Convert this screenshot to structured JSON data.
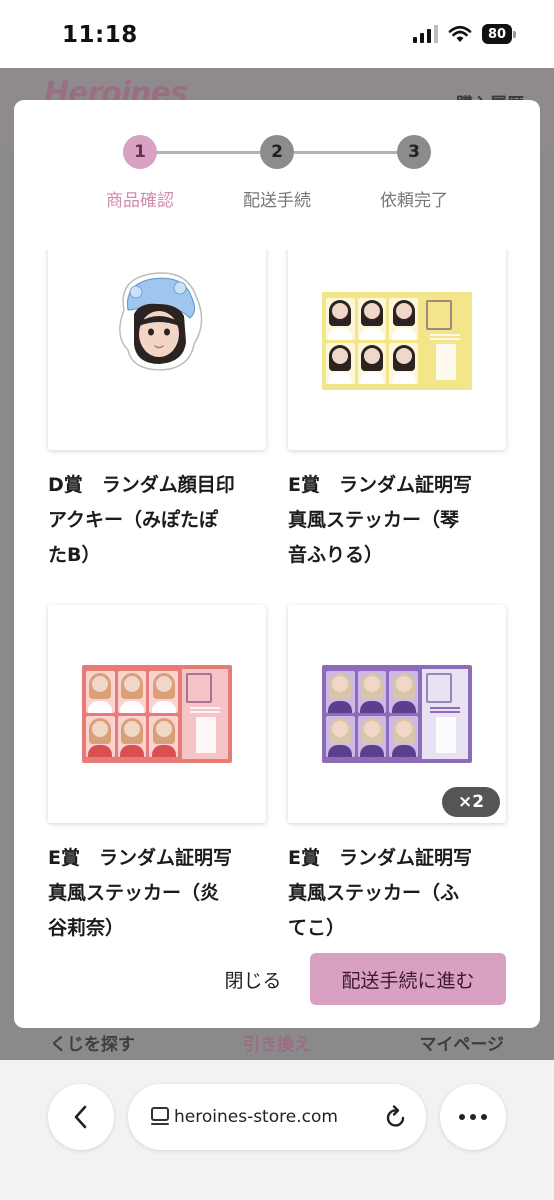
{
  "status_bar": {
    "time": "11:18",
    "battery": "80"
  },
  "background_page": {
    "logo": "Heroines",
    "header_right": "購入履歴",
    "nav": [
      "くじを探す",
      "引き換え",
      "マイページ"
    ]
  },
  "stepper": {
    "steps": [
      {
        "number": "1",
        "label": "商品確認",
        "active": true
      },
      {
        "number": "2",
        "label": "配送手続",
        "active": false
      },
      {
        "number": "3",
        "label": "依頼完了",
        "active": false
      }
    ]
  },
  "items": [
    {
      "title": "D賞　ランダム顔目印アクキー（みぽたぽB）",
      "lines": [
        "D賞　ランダム顔目印",
        "アクキー（みぽたぽ",
        "たB）"
      ],
      "image": "face-sticker",
      "quantity": ""
    },
    {
      "title": "E賞　ランダム証明写真風ステッカー（琴音ふりる）",
      "lines": [
        "E賞　ランダム証明写",
        "真風ステッカー（琴",
        "音ふりる）"
      ],
      "image": "sticker-sheet-yellow",
      "quantity": ""
    },
    {
      "title": "E賞　ランダム証明写真風ステッカー（炎谷莉奈）",
      "lines": [
        "E賞　ランダム証明写",
        "真風ステッカー（炎",
        "谷莉奈）"
      ],
      "image": "sticker-sheet-red",
      "quantity": ""
    },
    {
      "title": "E賞　ランダム証明写真風ステッカー（ふてこ）",
      "lines": [
        "E賞　ランダム証明写",
        "真風ステッカー（ふ",
        "てこ）"
      ],
      "image": "sticker-sheet-purple",
      "quantity": "×2"
    }
  ],
  "footer": {
    "close_label": "閉じる",
    "next_label": "配送手続に進む"
  },
  "browser": {
    "url": "heroines-store.com",
    "icons": [
      "back-arrow-icon",
      "tabs-icon",
      "reload-icon",
      "more-icon"
    ]
  },
  "colors": {
    "accent_pink": "#d9a1c1",
    "active_step_text": "#d08bb3",
    "sheet_yellow": "#f3e58a",
    "sheet_red": "#e77b78",
    "sheet_purple": "#8c6bb8"
  }
}
